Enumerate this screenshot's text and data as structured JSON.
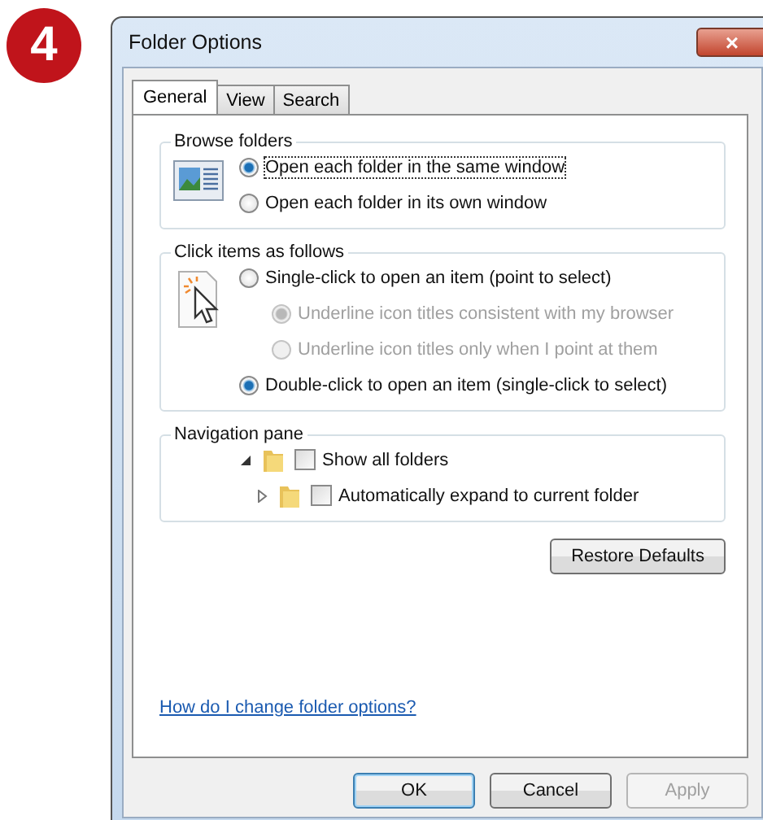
{
  "step_badge": "4",
  "window": {
    "title": "Folder Options",
    "close": "×"
  },
  "tabs": [
    {
      "label": "General",
      "selected": true
    },
    {
      "label": "View",
      "selected": false
    },
    {
      "label": "Search",
      "selected": false
    }
  ],
  "groups": [
    {
      "title": "Browse folders",
      "kind": "radios",
      "options": [
        {
          "label": "Open each folder in the same window",
          "selected": true,
          "disabled": false,
          "focused": true
        },
        {
          "label": "Open each folder in its own window",
          "selected": false,
          "disabled": false,
          "focused": false
        }
      ]
    },
    {
      "title": "Click items as follows",
      "kind": "radios",
      "options": [
        {
          "label": "Single-click to open an item (point to select)",
          "selected": false,
          "disabled": false,
          "focused": false,
          "children": [
            {
              "label": "Underline icon titles consistent with my browser",
              "selected": true,
              "disabled": true,
              "focused": false
            },
            {
              "label": "Underline icon titles only when I point at them",
              "selected": false,
              "disabled": true,
              "focused": false
            }
          ]
        },
        {
          "label": "Double-click to open an item (single-click to select)",
          "selected": true,
          "disabled": false,
          "focused": false
        }
      ]
    },
    {
      "title": "Navigation pane",
      "kind": "tree",
      "items": [
        {
          "label": "Show all folders",
          "checked": false,
          "expanded": true,
          "children": [
            {
              "label": "Automatically expand to current folder",
              "checked": false,
              "expanded": false
            }
          ]
        }
      ]
    }
  ],
  "restore_button": "Restore Defaults",
  "help_link": "How do I change folder options?",
  "buttons": [
    {
      "label": "OK",
      "default": true,
      "disabled": false
    },
    {
      "label": "Cancel",
      "default": false,
      "disabled": false
    },
    {
      "label": "Apply",
      "default": false,
      "disabled": true
    }
  ]
}
